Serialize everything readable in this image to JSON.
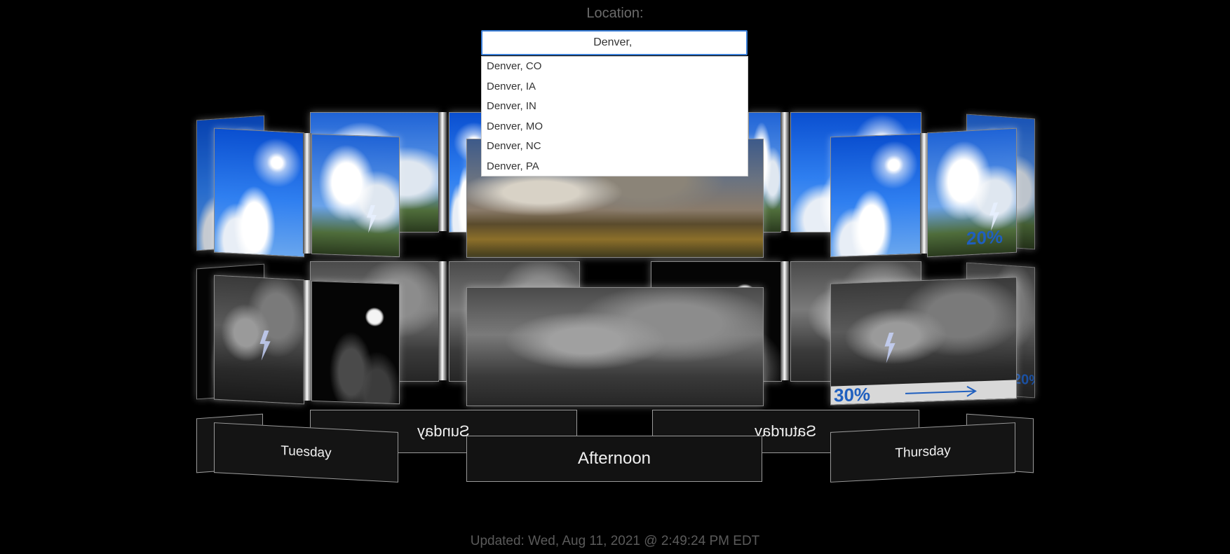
{
  "location": {
    "label": "Location:",
    "input_value": "Denver, ",
    "suggestions": [
      "Denver, CO",
      "Denver, IA",
      "Denver, IN",
      "Denver, MO",
      "Denver, NC",
      "Denver, PA"
    ]
  },
  "carousel": {
    "front_label": "Afternoon",
    "left_label": "Tuesday",
    "right_label": "Thursday",
    "back_left_label": "Sunday",
    "back_right_label": "Saturday",
    "badges": {
      "day_right_pct": "20%",
      "night_right_pct": "30%",
      "night_far_right_pct": "20%"
    }
  },
  "status": {
    "updated": "Updated: Wed, Aug 11, 2021 @ 2:49:24 PM EDT"
  },
  "colors": {
    "background": "#000000",
    "input_border": "#3b7fd8",
    "badge_blue": "#1f5fbf"
  }
}
